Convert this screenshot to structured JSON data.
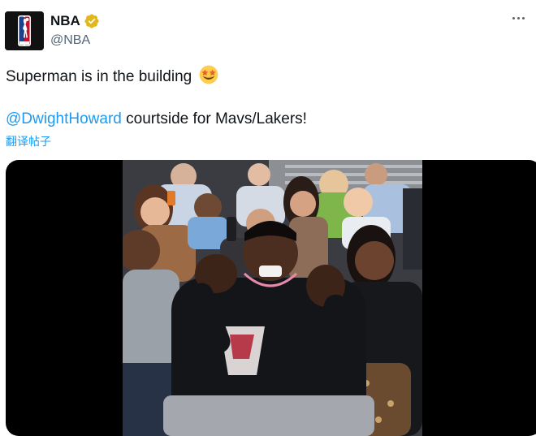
{
  "tweet": {
    "author": {
      "display_name": "NBA",
      "handle": "@NBA",
      "avatar_icon": "nba-logo-icon",
      "verified_icon": "verified-badge-icon",
      "verified_color": "#e2b719"
    },
    "more_icon": "more-options-icon",
    "text_line1": "Superman is in the building",
    "emoji_icon": "star-struck-emoji-icon",
    "mention": "@DwightHoward",
    "text_line2_rest": " courtside for Mavs/Lakers!",
    "translate_label": "翻译帖子",
    "media": {
      "type": "video",
      "thumbnail_icon": "courtside-video-thumbnail"
    }
  },
  "colors": {
    "link": "#1d9bf0",
    "text": "#0f1419",
    "secondary": "#536471",
    "media_bg": "#000000"
  }
}
